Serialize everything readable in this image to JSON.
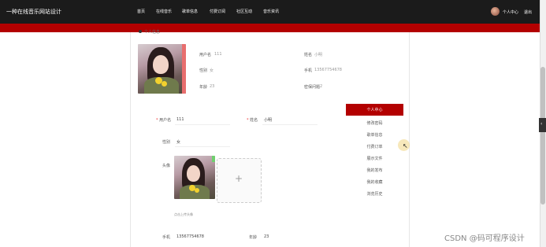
{
  "header": {
    "brand": "一种在线音乐网站设计",
    "nav": [
      "首页",
      "在线音乐",
      "歌单信息",
      "付费订阅",
      "社区互动",
      "音乐资讯"
    ],
    "user_center": "个人中心",
    "logout": "退出"
  },
  "profile": {
    "section_title": "个人信息",
    "username_label": "用户名",
    "username": "111",
    "gender_label": "性别",
    "gender": "女",
    "age_label": "年龄",
    "age": "23",
    "name_label": "姓名",
    "name": "小明",
    "phone_label": "手机",
    "phone": "13567754678",
    "security_q_label": "密保问题",
    "security_q": "2"
  },
  "form": {
    "username_label": "用户名",
    "username": "111",
    "name_label": "姓名",
    "name": "小明",
    "gender_label": "性别",
    "gender": "女",
    "avatar_label": "头像",
    "upload_plus": "+",
    "upload_hint": "点击上传头像",
    "phone_label": "手机",
    "phone": "13567754678",
    "age_label": "年龄",
    "age": "23",
    "required_mark": "*"
  },
  "side_menu": {
    "active": "个人中心",
    "items": [
      "修改密码",
      "歌单信息",
      "付费订单",
      "展示文件",
      "我的发布",
      "我的收藏",
      "浏览历史"
    ]
  },
  "side_toggle": "‹",
  "watermark": "CSDN @码可程序设计",
  "colors": {
    "accent": "#b30000",
    "topbar": "#1b1b1b"
  }
}
